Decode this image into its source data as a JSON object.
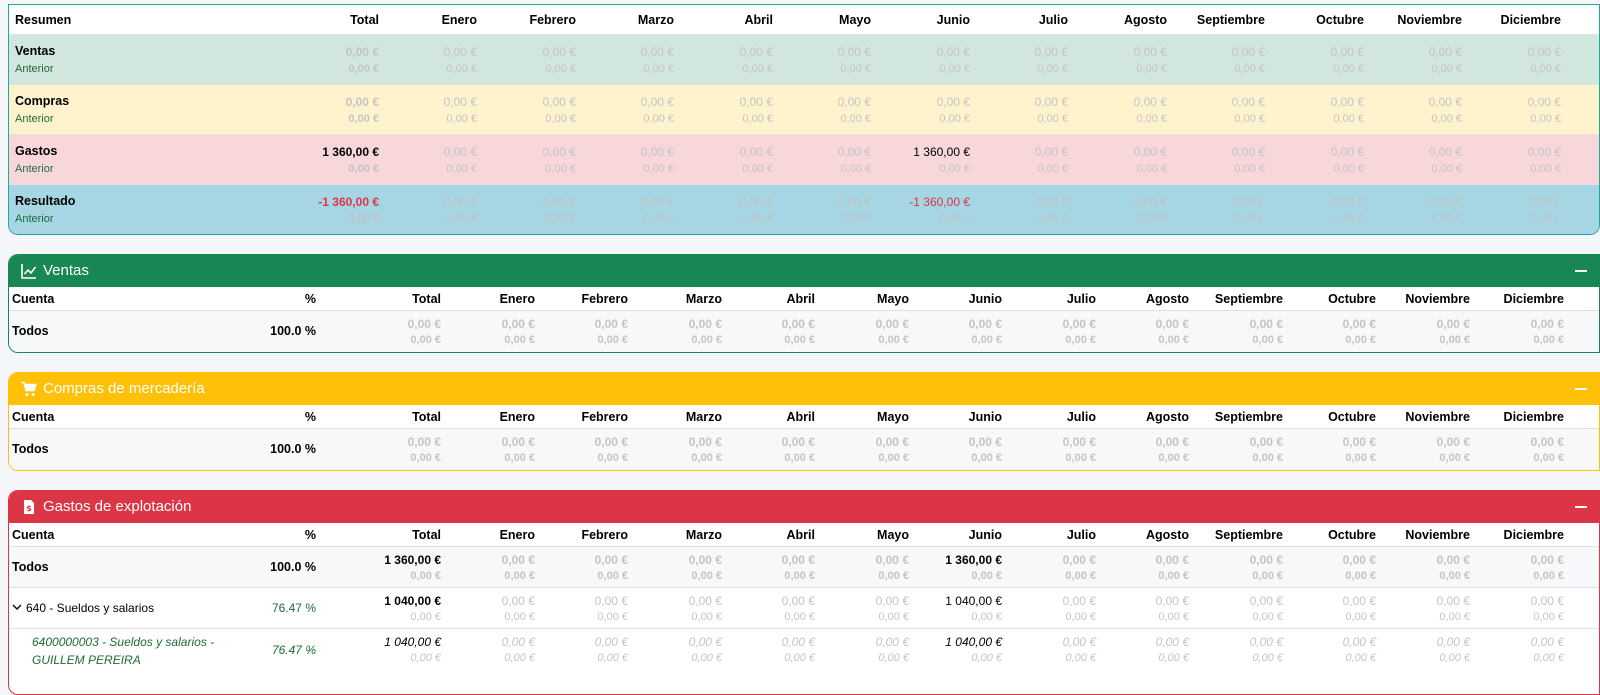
{
  "months": [
    "Enero",
    "Febrero",
    "Marzo",
    "Abril",
    "Mayo",
    "Junio",
    "Julio",
    "Agosto",
    "Septiembre",
    "Octubre",
    "Noviembre",
    "Diciembre"
  ],
  "summary": {
    "header": "Resumen",
    "total_header": "Total",
    "rows": [
      {
        "name": "Ventas",
        "prev": "Anterior",
        "total": "0,00 €",
        "total_prev": "0,00 €",
        "months": [
          "0,00 €",
          "0,00 €",
          "0,00 €",
          "0,00 €",
          "0,00 €",
          "0,00 €",
          "0,00 €",
          "0,00 €",
          "0,00 €",
          "0,00 €",
          "0,00 €",
          "0,00 €"
        ],
        "months_prev": [
          "0,00 €",
          "0,00 €",
          "0,00 €",
          "0,00 €",
          "0,00 €",
          "0,00 €",
          "0,00 €",
          "0,00 €",
          "0,00 €",
          "0,00 €",
          "0,00 €",
          "0,00 €"
        ],
        "bg": "#d1e7dd"
      },
      {
        "name": "Compras",
        "prev": "Anterior",
        "total": "0,00 €",
        "total_prev": "0,00 €",
        "months": [
          "0,00 €",
          "0,00 €",
          "0,00 €",
          "0,00 €",
          "0,00 €",
          "0,00 €",
          "0,00 €",
          "0,00 €",
          "0,00 €",
          "0,00 €",
          "0,00 €",
          "0,00 €"
        ],
        "months_prev": [
          "0,00 €",
          "0,00 €",
          "0,00 €",
          "0,00 €",
          "0,00 €",
          "0,00 €",
          "0,00 €",
          "0,00 €",
          "0,00 €",
          "0,00 €",
          "0,00 €",
          "0,00 €"
        ],
        "bg": "#fff3cd"
      },
      {
        "name": "Gastos",
        "prev": "Anterior",
        "total": "1 360,00 €",
        "total_prev": "0,00 €",
        "months": [
          "0,00 €",
          "0,00 €",
          "0,00 €",
          "0,00 €",
          "0,00 €",
          "1 360,00 €",
          "0,00 €",
          "0,00 €",
          "0,00 €",
          "0,00 €",
          "0,00 €",
          "0,00 €"
        ],
        "months_prev": [
          "0,00 €",
          "0,00 €",
          "0,00 €",
          "0,00 €",
          "0,00 €",
          "0,00 €",
          "0,00 €",
          "0,00 €",
          "0,00 €",
          "0,00 €",
          "0,00 €",
          "0,00 €"
        ],
        "bg": "#f8d7da"
      },
      {
        "name": "Resultado",
        "prev": "Anterior",
        "total": "-1 360,00 €",
        "total_prev": "0,00 €",
        "months": [
          "0,00 €",
          "0,00 €",
          "0,00 €",
          "0,00 €",
          "0,00 €",
          "-1 360,00 €",
          "0,00 €",
          "0,00 €",
          "0,00 €",
          "0,00 €",
          "0,00 €",
          "0,00 €"
        ],
        "months_prev": [
          "0,00 €",
          "0,00 €",
          "0,00 €",
          "0,00 €",
          "0,00 €",
          "0,00 €",
          "0,00 €",
          "0,00 €",
          "0,00 €",
          "0,00 €",
          "0,00 €",
          "0,00 €"
        ],
        "bg": "#a6d5e4"
      }
    ]
  },
  "sections": [
    {
      "key": "ventas",
      "title": "Ventas",
      "icon": "line-chart-icon",
      "color": "#198754",
      "col_account": "Cuenta",
      "col_pct": "%",
      "col_total": "Total",
      "rows": [
        {
          "type": "all",
          "name": "Todos",
          "pct": "100.0 %",
          "total": "0,00 €",
          "total_prev": "0,00 €",
          "months": [
            "0,00 €",
            "0,00 €",
            "0,00 €",
            "0,00 €",
            "0,00 €",
            "0,00 €",
            "0,00 €",
            "0,00 €",
            "0,00 €",
            "0,00 €",
            "0,00 €",
            "0,00 €"
          ],
          "months_prev": [
            "0,00 €",
            "0,00 €",
            "0,00 €",
            "0,00 €",
            "0,00 €",
            "0,00 €",
            "0,00 €",
            "0,00 €",
            "0,00 €",
            "0,00 €",
            "0,00 €",
            "0,00 €"
          ]
        }
      ]
    },
    {
      "key": "compras",
      "title": "Compras de mercadería",
      "icon": "shopping-cart-icon",
      "color": "#ffc107",
      "col_account": "Cuenta",
      "col_pct": "%",
      "col_total": "Total",
      "rows": [
        {
          "type": "all",
          "name": "Todos",
          "pct": "100.0 %",
          "total": "0,00 €",
          "total_prev": "0,00 €",
          "months": [
            "0,00 €",
            "0,00 €",
            "0,00 €",
            "0,00 €",
            "0,00 €",
            "0,00 €",
            "0,00 €",
            "0,00 €",
            "0,00 €",
            "0,00 €",
            "0,00 €",
            "0,00 €"
          ],
          "months_prev": [
            "0,00 €",
            "0,00 €",
            "0,00 €",
            "0,00 €",
            "0,00 €",
            "0,00 €",
            "0,00 €",
            "0,00 €",
            "0,00 €",
            "0,00 €",
            "0,00 €",
            "0,00 €"
          ]
        }
      ]
    },
    {
      "key": "gastos",
      "title": "Gastos de explotación",
      "icon": "invoice-icon",
      "color": "#dc3545",
      "col_account": "Cuenta",
      "col_pct": "%",
      "col_total": "Total",
      "rows": [
        {
          "type": "all",
          "name": "Todos",
          "pct": "100.0 %",
          "total": "1 360,00 €",
          "total_prev": "0,00 €",
          "months": [
            "0,00 €",
            "0,00 €",
            "0,00 €",
            "0,00 €",
            "0,00 €",
            "1 360,00 €",
            "0,00 €",
            "0,00 €",
            "0,00 €",
            "0,00 €",
            "0,00 €",
            "0,00 €"
          ],
          "months_prev": [
            "0,00 €",
            "0,00 €",
            "0,00 €",
            "0,00 €",
            "0,00 €",
            "0,00 €",
            "0,00 €",
            "0,00 €",
            "0,00 €",
            "0,00 €",
            "0,00 €",
            "0,00 €"
          ]
        },
        {
          "type": "group",
          "name": "640 - Sueldos y salarios",
          "pct": "76.47 %",
          "total": "1 040,00 €",
          "total_prev": "0,00 €",
          "months": [
            "0,00 €",
            "0,00 €",
            "0,00 €",
            "0,00 €",
            "0,00 €",
            "1 040,00 €",
            "0,00 €",
            "0,00 €",
            "0,00 €",
            "0,00 €",
            "0,00 €",
            "0,00 €"
          ],
          "months_prev": [
            "0,00 €",
            "0,00 €",
            "0,00 €",
            "0,00 €",
            "0,00 €",
            "0,00 €",
            "0,00 €",
            "0,00 €",
            "0,00 €",
            "0,00 €",
            "0,00 €",
            "0,00 €"
          ]
        },
        {
          "type": "account",
          "name": "6400000003 - Sueldos y salarios - GUILLEM PEREIRA",
          "pct": "76.47 %",
          "total": "1 040,00 €",
          "total_prev": "0,00 €",
          "months": [
            "0,00 €",
            "0,00 €",
            "0,00 €",
            "0,00 €",
            "0,00 €",
            "1 040,00 €",
            "0,00 €",
            "0,00 €",
            "0,00 €",
            "0,00 €",
            "0,00 €",
            "0,00 €"
          ],
          "months_prev": [
            "0,00 €",
            "0,00 €",
            "0,00 €",
            "0,00 €",
            "0,00 €",
            "0,00 €",
            "0,00 €",
            "0,00 €",
            "0,00 €",
            "0,00 €",
            "0,00 €",
            "0,00 €"
          ]
        }
      ]
    }
  ]
}
